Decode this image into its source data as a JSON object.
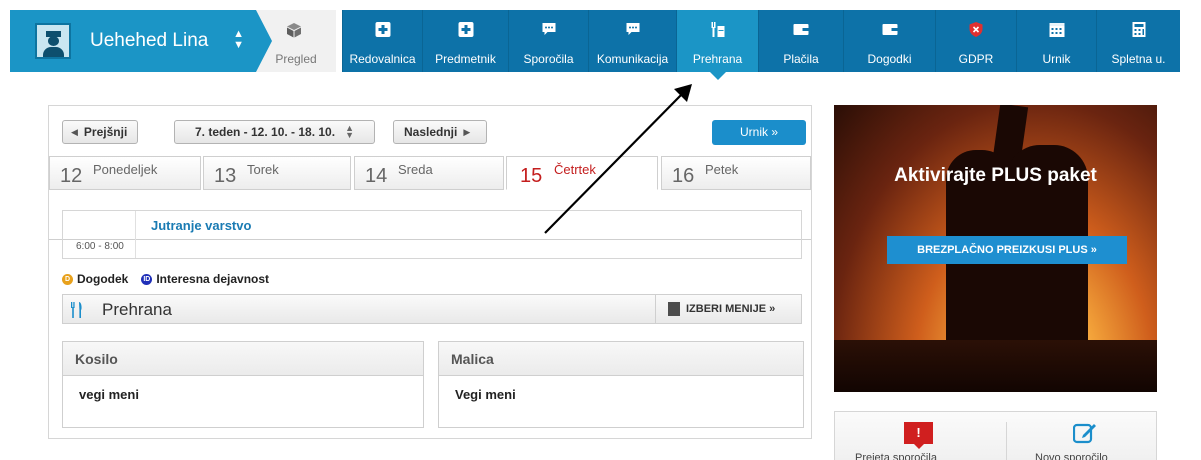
{
  "user": {
    "name": "Uehehed Lina"
  },
  "pregled": {
    "label": "Pregled"
  },
  "nav": [
    {
      "label": "Redovalnica",
      "icon": "plus-square-icon"
    },
    {
      "label": "Predmetnik",
      "icon": "plus-square-icon"
    },
    {
      "label": "Sporočila",
      "icon": "chat-bubble-icon"
    },
    {
      "label": "Komunikacija",
      "icon": "chat-bubble-icon"
    },
    {
      "label": "Prehrana",
      "icon": "food-icon",
      "active": true
    },
    {
      "label": "Plačila",
      "icon": "wallet-icon"
    },
    {
      "label": "Dogodki",
      "icon": "wallet-icon"
    },
    {
      "label": "GDPR",
      "icon": "shield-icon"
    },
    {
      "label": "Urnik",
      "icon": "calendar-icon"
    },
    {
      "label": "Spletna u.",
      "icon": "calculator-icon"
    }
  ],
  "toolbar": {
    "prev": "Prejšnji",
    "week": "7. teden - 12. 10. - 18. 10.",
    "next": "Naslednji",
    "urnik": "Urnik »"
  },
  "days": [
    {
      "num": "12",
      "name": "Ponedeljek"
    },
    {
      "num": "13",
      "name": "Torek"
    },
    {
      "num": "14",
      "name": "Sreda"
    },
    {
      "num": "15",
      "name": "Četrtek",
      "active": true
    },
    {
      "num": "16",
      "name": "Petek"
    }
  ],
  "event": {
    "title": "Jutranje varstvo",
    "time": "6:00 - 8:00"
  },
  "legend": {
    "dogodek": "Dogodek",
    "dogodek_badge": "D",
    "interesna": "Interesna dejavnost",
    "interesna_badge": "ID"
  },
  "prehrana": {
    "title": "Prehrana",
    "izberi": "IZBERI MENIJE »"
  },
  "meals": [
    {
      "header": "Kosilo",
      "value": "vegi meni"
    },
    {
      "header": "Malica",
      "value": "Vegi meni"
    }
  ],
  "ad": {
    "title": "Aktivirajte PLUS paket",
    "button": "BREZPLAČNO PREIZKUSI PLUS »"
  },
  "quick": {
    "messages_badge": "!",
    "messages_label": "Prejeta sporočila",
    "new_label": "Novo sporočilo"
  },
  "colors": {
    "nav": "#0d72a8",
    "active": "#1b95c6",
    "accent": "#1b8ecb",
    "today": "#c41e1e"
  }
}
